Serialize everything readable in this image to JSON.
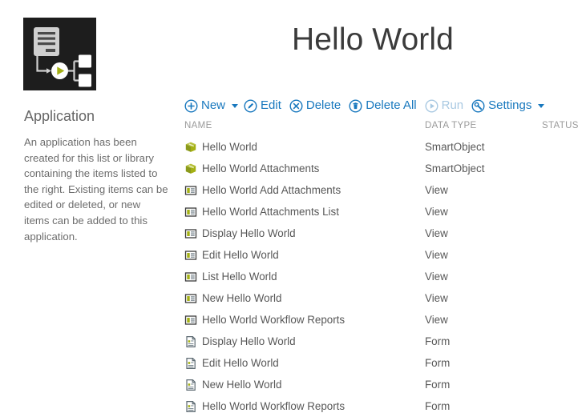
{
  "header": {
    "title": "Hello World",
    "app_icon": "application-workflow-icon"
  },
  "sidebar": {
    "heading": "Application",
    "description": "An application has been created for this list or library containing the items listed to the right. Existing items can be edited or deleted, or new items can be added to this application."
  },
  "toolbar": {
    "new_label": "New",
    "new_icon": "plus-circle-icon",
    "new_caret_icon": "chevron-down-icon",
    "edit_label": "Edit",
    "edit_icon": "pencil-circle-icon",
    "delete_label": "Delete",
    "delete_icon": "x-circle-icon",
    "delete_all_label": "Delete All",
    "delete_all_icon": "trash-circle-icon",
    "run_label": "Run",
    "run_icon": "play-circle-icon",
    "run_disabled": true,
    "settings_label": "Settings",
    "settings_icon": "wrench-circle-icon",
    "settings_caret_icon": "chevron-down-icon"
  },
  "table": {
    "columns": {
      "name": "NAME",
      "data_type": "DATA TYPE",
      "status": "STATUS"
    },
    "rows": [
      {
        "name": "Hello World",
        "type": "SmartObject",
        "status": "",
        "icon": "smartobject-icon"
      },
      {
        "name": "Hello World Attachments",
        "type": "SmartObject",
        "status": "",
        "icon": "smartobject-icon"
      },
      {
        "name": "Hello World Add Attachments",
        "type": "View",
        "status": "",
        "icon": "view-icon"
      },
      {
        "name": "Hello World Attachments List",
        "type": "View",
        "status": "",
        "icon": "view-icon"
      },
      {
        "name": "Display Hello World",
        "type": "View",
        "status": "",
        "icon": "view-icon"
      },
      {
        "name": "Edit Hello World",
        "type": "View",
        "status": "",
        "icon": "view-icon"
      },
      {
        "name": "List Hello World",
        "type": "View",
        "status": "",
        "icon": "view-icon"
      },
      {
        "name": "New Hello World",
        "type": "View",
        "status": "",
        "icon": "view-icon"
      },
      {
        "name": "Hello World Workflow Reports",
        "type": "View",
        "status": "",
        "icon": "view-icon"
      },
      {
        "name": "Display Hello World",
        "type": "Form",
        "status": "",
        "icon": "form-icon"
      },
      {
        "name": "Edit Hello World",
        "type": "Form",
        "status": "",
        "icon": "form-icon"
      },
      {
        "name": "New Hello World",
        "type": "Form",
        "status": "",
        "icon": "form-icon"
      },
      {
        "name": "Hello World Workflow Reports",
        "type": "Form",
        "status": "",
        "icon": "form-icon"
      }
    ]
  },
  "colors": {
    "accent_blue": "#1878be",
    "accent_blue_disabled": "#a9c9e2",
    "olive": "#a4b014",
    "icon_dark": "#1d1d1d",
    "text_grey": "#585858",
    "header_grey": "#9a9a9a"
  }
}
